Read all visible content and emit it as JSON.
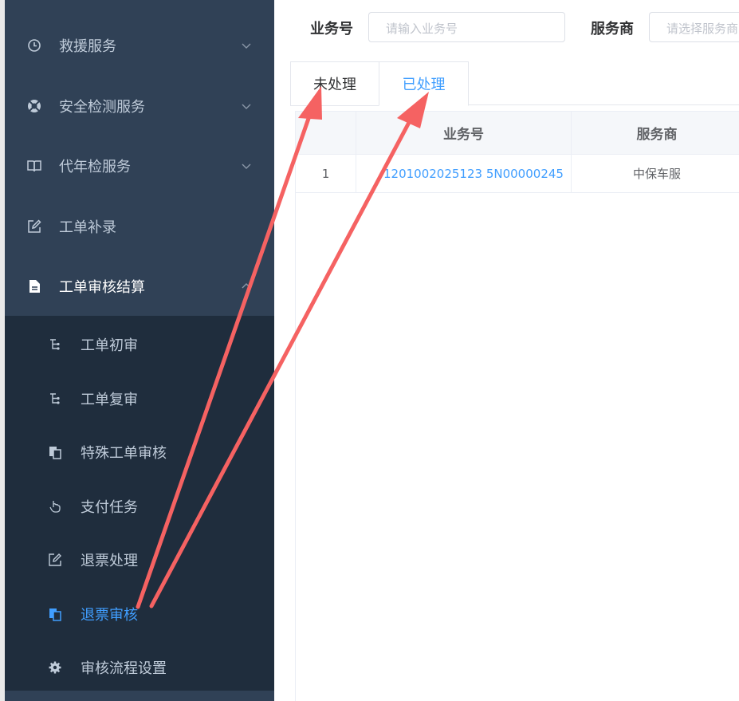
{
  "sidebar": {
    "menu": [
      {
        "label": "救援服务",
        "icon": "clock-icon"
      },
      {
        "label": "安全检测服务",
        "icon": "lifebuoy-icon"
      },
      {
        "label": "代年检服务",
        "icon": "book-icon"
      },
      {
        "label": "工单补录",
        "icon": "edit-icon"
      },
      {
        "label": "工单审核结算",
        "icon": "document-icon"
      }
    ],
    "submenu": [
      {
        "label": "工单初审",
        "icon": "flow-icon"
      },
      {
        "label": "工单复审",
        "icon": "flow-icon"
      },
      {
        "label": "特殊工单审核",
        "icon": "copy-icon"
      },
      {
        "label": "支付任务",
        "icon": "hand-pointer-icon"
      },
      {
        "label": "退票处理",
        "icon": "edit-icon"
      },
      {
        "label": "退票审核",
        "icon": "copy-icon"
      },
      {
        "label": "审核流程设置",
        "icon": "gear-icon"
      }
    ],
    "active_submenu": "退票审核"
  },
  "search": {
    "business_no_label": "业务号",
    "business_no_placeholder": "请输入业务号",
    "provider_label": "服务商",
    "provider_placeholder": "请选择服务商"
  },
  "tabs": [
    {
      "label": "未处理"
    },
    {
      "label": "已处理"
    }
  ],
  "active_tab": "已处理",
  "table": {
    "columns": [
      "",
      "业务号",
      "服务商"
    ],
    "rows": [
      {
        "index": "1",
        "business_no": "1201002025123 5N00000245",
        "provider": "中保车服"
      }
    ]
  },
  "colors": {
    "sidebar_bg": "#304156",
    "submenu_bg": "#1f2d3d",
    "accent": "#409eff",
    "annotation_arrow": "#f56262"
  }
}
